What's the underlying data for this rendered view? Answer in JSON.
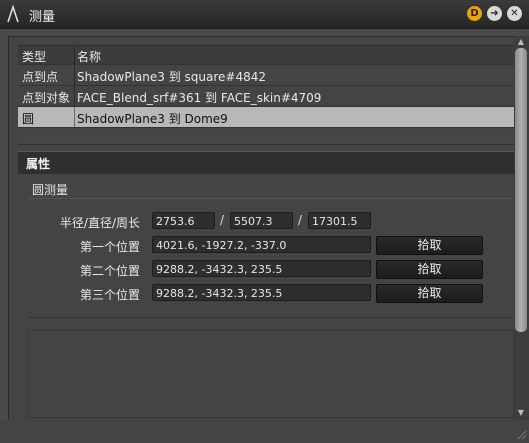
{
  "window": {
    "title": "测量",
    "btn_d": "D",
    "btn_arrow": "➜",
    "btn_close": "✕"
  },
  "table": {
    "headers": [
      "类型",
      "名称"
    ],
    "rows": [
      {
        "type": "点到点",
        "name": "ShadowPlane3  到  square#4842"
      },
      {
        "type": "点到对象",
        "name": "FACE_Blend_srf#361  到  FACE_skin#4709"
      },
      {
        "type": "圆",
        "name": "ShadowPlane3  到  Dome9",
        "selected": true
      }
    ]
  },
  "properties": {
    "header": "属性",
    "group_title": "圆测量",
    "radius_label": "半径/直径/周长",
    "radius": "2753.6",
    "diameter": "5507.3",
    "circumference": "17301.5",
    "slash": "/",
    "positions": [
      {
        "label": "第一个位置",
        "value": "4021.6, -1927.2, -337.0",
        "button": "拾取"
      },
      {
        "label": "第二个位置",
        "value": "9288.2, -3432.3, 235.5",
        "button": "拾取"
      },
      {
        "label": "第三个位置",
        "value": "9288.2, -3432.3, 235.5",
        "button": "拾取"
      }
    ]
  },
  "scrollbar": {
    "up": "▲",
    "down": "▼"
  }
}
